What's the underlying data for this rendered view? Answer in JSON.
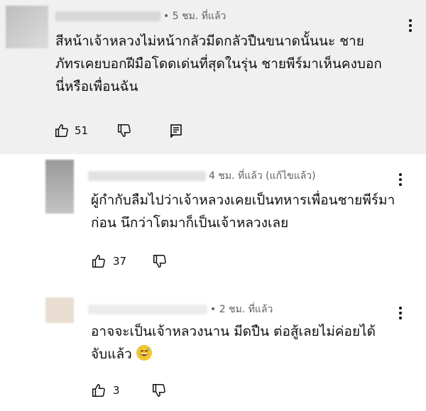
{
  "comments": [
    {
      "timestamp": "• 5 ชม. ที่แล้ว",
      "text": "สีหน้าเจ้าหลวงไม่หน้ากลัวมีดกลัวปืนขนาดนั้นนะ ชายภัทรเคยบอกฝีมือโดดเด่นที่สุดในรุ่น ชายพีร์มาเห็นคงบอกนี่หรือเพื่อนฉัน",
      "likes": "51",
      "icons": [
        "like-icon",
        "dislike-icon",
        "reply-icon",
        "more-vert-icon"
      ]
    },
    {
      "timestamp": "4 ชม. ที่แล้ว (แก้ไขแล้ว)",
      "text": "ผู้กำกับลืมไปว่าเจ้าหลวงเคยเป็นทหารเพื่อนชายพีร์มาก่อน นึกว่าโตมาก็เป็นเจ้าหลวงเลย",
      "likes": "37",
      "icons": [
        "like-icon",
        "dislike-icon",
        "more-vert-icon"
      ]
    },
    {
      "timestamp": "• 2 ชม. ที่แล้ว",
      "text": "อาจจะเป็นเจ้าหลวงนาน มีดปืน ต่อสู้เลยไม่ค่อยได้จับแล้ว",
      "emoji": "😅",
      "likes": "3",
      "icons": [
        "like-icon",
        "dislike-icon",
        "more-vert-icon"
      ]
    }
  ],
  "colors": {
    "highlight_bg": "#f0f0f0",
    "text": "#0f0f0f",
    "meta": "#606060"
  }
}
